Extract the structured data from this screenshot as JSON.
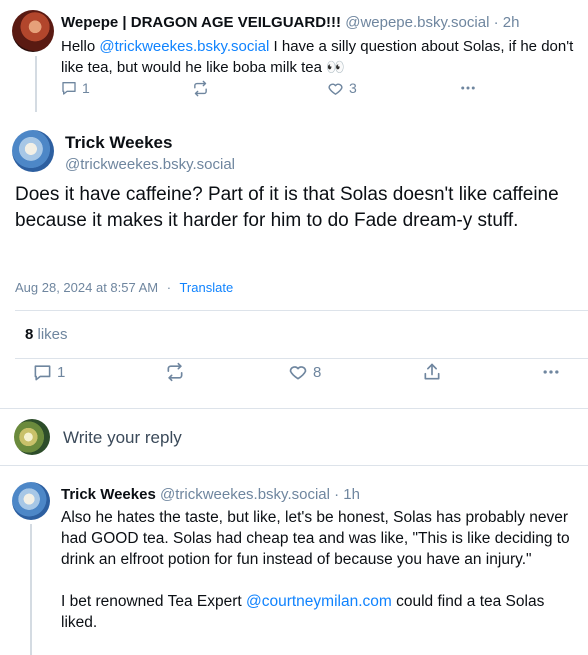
{
  "parent_post": {
    "author_name": "Wepepe | DRAGON AGE VEILGUARD!!!",
    "author_handle": "@wepepe.bsky.social",
    "time": "· 2h",
    "text_before": "Hello ",
    "mention": "@trickweekes.bsky.social",
    "text_after": " I have a silly question about Solas, if he don't like tea, but would he like boba milk tea 👀",
    "reply_count": "1",
    "like_count": "3"
  },
  "main_post": {
    "author_name": "Trick Weekes",
    "author_handle": "@trickweekes.bsky.social",
    "text": "Does it have caffeine? Part of it is that Solas doesn't like caffeine because it makes it harder for him to do Fade dream-y stuff.",
    "timestamp": "Aug 28, 2024 at 8:57 AM",
    "separator": "·",
    "translate_label": "Translate",
    "likes_count": "8",
    "likes_label": "likes",
    "reply_count": "1",
    "like_count": "8"
  },
  "reply_composer": {
    "placeholder": "Write your reply"
  },
  "reply_post": {
    "author_name": "Trick Weekes",
    "author_handle": "@trickweekes.bsky.social",
    "time": "· 1h",
    "paragraph1": "Also he hates the taste, but like, let's be honest, Solas has probably never had GOOD tea. Solas had cheap tea and was like, \"This is like deciding to drink an elfroot potion for fun instead of because you have an injury.\"",
    "paragraph2_before": "I bet renowned Tea Expert ",
    "paragraph2_mention": "@courtneymilan.com",
    "paragraph2_after": " could find a tea Solas liked."
  },
  "colors": {
    "accent": "#1083fe",
    "muted": "#6f869f",
    "divider": "#dde3ea"
  }
}
